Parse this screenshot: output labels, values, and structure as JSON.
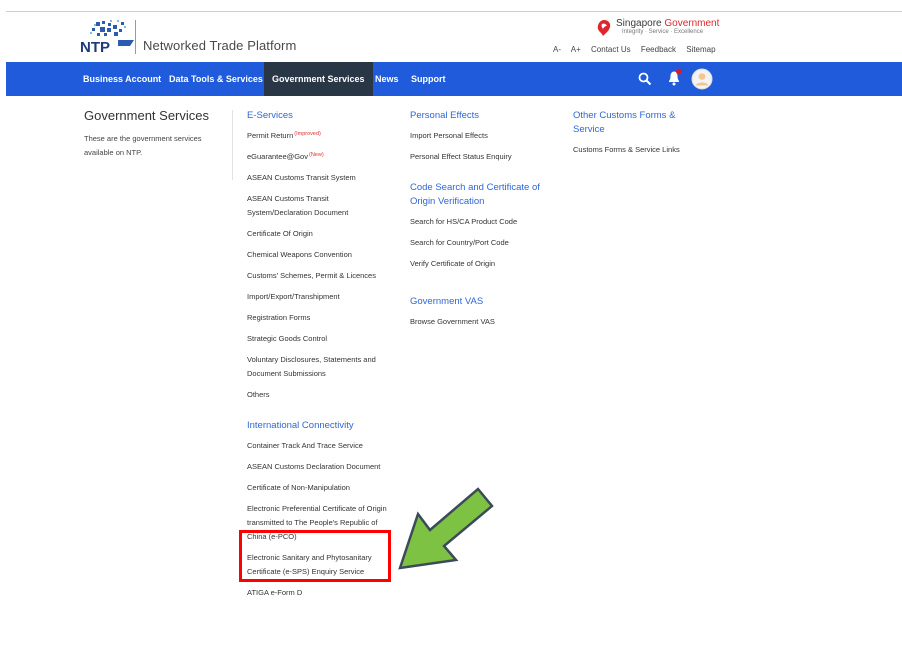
{
  "header": {
    "brand_name": "Networked Trade Platform",
    "sg_gov_title_a": "Singapore ",
    "sg_gov_title_b": "Government",
    "sg_gov_tagline": "Integrity · Service · Excellence",
    "util_links": [
      "A-",
      "A+",
      "Contact Us",
      "Feedback",
      "Sitemap"
    ]
  },
  "nav": {
    "items": [
      "Business Account",
      "Data Tools & Services",
      "Government Services",
      "News",
      "Support"
    ],
    "active": "Government Services"
  },
  "page": {
    "title": "Government Services",
    "description": "These are the government services available on NTP."
  },
  "eservices": {
    "heading": "E-Services",
    "items": [
      {
        "label": "Permit Return",
        "badge": "(Improved)"
      },
      {
        "label": "eGuarantee@Gov",
        "badge": "(New)"
      },
      {
        "label": "ASEAN Customs Transit System"
      },
      {
        "label": "ASEAN Customs Transit System/Declaration Document"
      },
      {
        "label": "Certificate Of Origin"
      },
      {
        "label": "Chemical Weapons Convention"
      },
      {
        "label": "Customs' Schemes, Permit & Licences"
      },
      {
        "label": "Import/Export/Transhipment"
      },
      {
        "label": "Registration Forms"
      },
      {
        "label": "Strategic Goods Control"
      },
      {
        "label": "Voluntary Disclosures, Statements and Document Submissions"
      },
      {
        "label": "Others"
      }
    ]
  },
  "intl": {
    "heading": "International Connectivity",
    "items": [
      {
        "label": "Container Track And Trace Service"
      },
      {
        "label": "ASEAN Customs Declaration Document"
      },
      {
        "label": "Certificate of Non-Manipulation"
      },
      {
        "label": "Electronic Preferential Certificate of Origin transmitted to The People's Republic of China (e-PCO)"
      },
      {
        "label": "Electronic Sanitary and Phytosanitary Certificate (e-SPS) Enquiry Service"
      },
      {
        "label": "ATIGA e-Form D"
      }
    ]
  },
  "personal": {
    "heading": "Personal Effects",
    "items": [
      "Import Personal Effects",
      "Personal Effect Status Enquiry"
    ]
  },
  "codesearch": {
    "heading": "Code Search and Certificate of Origin Verification",
    "items": [
      "Search for HS/CA Product Code",
      "Search for Country/Port Code",
      "Verify Certificate of Origin"
    ]
  },
  "vas": {
    "heading": "Government VAS",
    "items": [
      "Browse Government VAS"
    ]
  },
  "other": {
    "heading": "Other Customs Forms & Service",
    "items": [
      "Customs Forms & Service Links"
    ]
  },
  "colors": {
    "nav_bg": "#1f5bdb",
    "nav_active_bg": "#293645",
    "heading_blue": "#2f66d6",
    "highlight_red": "#ff0000",
    "arrow_green": "#7dc242"
  },
  "icons": [
    "ntp-logo-icon",
    "singapore-lion-icon",
    "search-icon",
    "bell-icon",
    "avatar-icon",
    "green-arrow-icon"
  ]
}
